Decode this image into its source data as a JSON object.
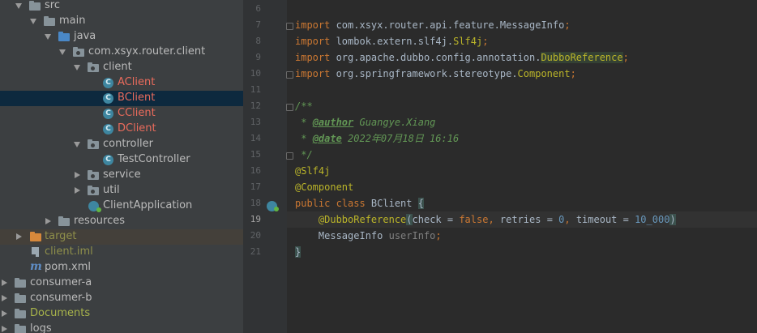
{
  "tree": {
    "src": "src",
    "main": "main",
    "java": "java",
    "package": "com.xsyx.router.client",
    "client_folder": "client",
    "aclient": "AClient",
    "bclient": "BClient",
    "cclient": "CClient",
    "dclient": "DClient",
    "controller_folder": "controller",
    "testcontroller": "TestController",
    "service_folder": "service",
    "util_folder": "util",
    "clientapplication": "ClientApplication",
    "resources": "resources",
    "target": "target",
    "client_iml": "client.iml",
    "pom_xml": "pom.xml",
    "consumer_a": "consumer-a",
    "consumer_b": "consumer-b",
    "documents": "Documents",
    "logs": "logs",
    "class_icon_letter": "C"
  },
  "editor": {
    "line_numbers": [
      "6",
      "7",
      "8",
      "9",
      "10",
      "11",
      "12",
      "13",
      "14",
      "15",
      "16",
      "17",
      "18",
      "19",
      "20",
      "21"
    ],
    "current_line": "19",
    "kw_import": "import",
    "l7_rest": " com.xsyx.router.api.feature.MessageInfo",
    "l8_rest": " lombok.extern.slf4j.",
    "l8_cls": "Slf4j",
    "l9_rest": " org.apache.dubbo.config.annotation.",
    "l9_cls": "DubboReference",
    "l10_rest": " org.springframework.stereotype.",
    "l10_cls": "Component",
    "semi": ";",
    "doc_open": "/**",
    "doc_star": " * ",
    "author_tag": "@author",
    "author_val": " Guangye.Xiang",
    "date_tag": "@date",
    "date_val": " 2022年07月18日 16:16",
    "doc_close": " */",
    "ann_slf4j": "@Slf4j",
    "ann_component": "@Component",
    "kw_public_class": "public class",
    "class_name": " BClient ",
    "open_brace": "{",
    "indent": "    ",
    "ann_dubbo": "@DubboReference",
    "paren_open": "(",
    "p_check": "check = ",
    "v_false": "false",
    "comma1": ", ",
    "p_retries": "retries = ",
    "v_zero": "0",
    "comma2": ", ",
    "p_timeout": "timeout = ",
    "v_timeout": "10_000",
    "paren_close": ")",
    "field_type": "MessageInfo ",
    "field_name": "userInfo",
    "close_brace": "}"
  },
  "colors": {
    "tree_bg": "#3c3f41",
    "editor_bg": "#2b2b2b",
    "keyword": "#cc7832",
    "annotation": "#bbb529",
    "number": "#6897bb",
    "doc_comment": "#629755",
    "modified_file": "#ea6b5c",
    "selection": "#0d293e"
  }
}
